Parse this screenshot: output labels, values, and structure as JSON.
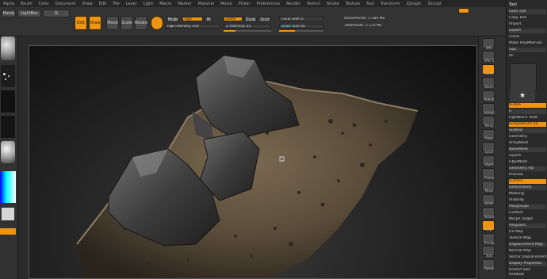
{
  "menubar": {
    "items": [
      "Alpha",
      "Brush",
      "Color",
      "Document",
      "Draw",
      "Edit",
      "File",
      "Layer",
      "Light",
      "Macro",
      "Marker",
      "Material",
      "Movie",
      "Picker",
      "Preferences",
      "Render",
      "Stencil",
      "Stroke",
      "Texture",
      "Tool",
      "Transform",
      "Zplugin",
      "Zscript"
    ]
  },
  "topshelf": {
    "home_label": "Home",
    "lightbox_label": "LightBox",
    "edit_label": "Edit",
    "draw_label": "Draw",
    "move_label": "Move",
    "scale_label": "Scale",
    "rotate_label": "Rotate",
    "mrgb_label": "Mrgb",
    "rgb_label": "Rgb",
    "m_label": "M",
    "zadd_label": "Zadd",
    "zsub_label": "Zsub",
    "zcut_label": "Zcut",
    "focal_label": "Focal Shift 0",
    "draw_size_label": "Draw Size 64",
    "rgb_intensity_label": "Rgb Intensity 100",
    "z_intensity_label": "Z Intensity 25",
    "active_points_label": "ActivePoints: 1.284 Mil",
    "total_points_label": "TotalPoints: 2.135 Mil",
    "draw_size_fill": 0.35,
    "z_intensity_fill": 0.25
  },
  "rightshelf": {
    "buttons": [
      "BPR",
      "SPix 3",
      "Scroll",
      "Zoom",
      "Actual",
      "AAHalf",
      "Persp",
      "Floor",
      "Local",
      "LSym",
      "Frame",
      "Move",
      "Scale",
      "Rotate",
      "PolyF",
      "Transp",
      "Solo",
      "Xpose"
    ]
  },
  "toolpanel": {
    "title": "Tool",
    "items": [
      "Load Tool",
      "Copy Tool",
      "Import",
      "Export",
      "Clone",
      "Make PolyMesh3D",
      "GoZ",
      "All",
      "Visible",
      "R",
      "Lightbox ▸ Tools",
      "SimpleBrush 48",
      "Subtool",
      "Geometry",
      "ArrayMesh",
      "NanoMesh",
      "Layers",
      "FiberMesh",
      "Geometry HD",
      "Preview",
      "Surface",
      "Deformation",
      "Masking",
      "Visibility",
      "Polygroups",
      "Contact",
      "Morph Target",
      "Polypaint",
      "UV Map",
      "Texture Map",
      "Displacement Map",
      "Normal Map",
      "Vector Displacement Map",
      "Display Properties",
      "Unified Skin",
      "Initialize",
      "Import",
      "Export"
    ],
    "accent": "#f0930f"
  }
}
